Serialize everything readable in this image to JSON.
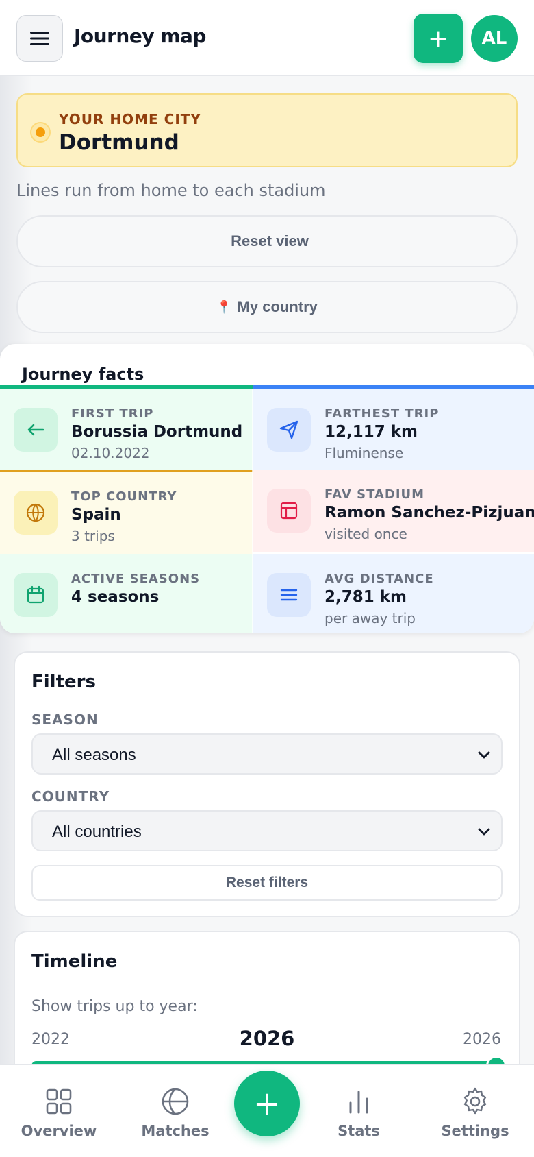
{
  "header": {
    "title": "Journey map",
    "add_label": "+",
    "avatar_initials": "AL"
  },
  "home": {
    "label": "YOUR HOME CITY",
    "city": "Dortmund"
  },
  "map_note": "Lines run from home to each stadium",
  "buttons": {
    "reset_view": "Reset view",
    "reset_view_icon": "",
    "my_country": "My country",
    "my_country_icon": "📍"
  },
  "facts": {
    "title": "Journey facts",
    "items": [
      {
        "label": "FIRST TRIP",
        "value": "Borussia Dortmund",
        "sub": "02.10.2022",
        "icon": "arrow-left-icon",
        "color": "#10b77f"
      },
      {
        "label": "FARTHEST TRIP",
        "value": "12,117 km",
        "sub": "Fluminense",
        "icon": "send-icon",
        "color": "#3b82f6"
      },
      {
        "label": "TOP COUNTRY",
        "value": "Spain",
        "sub": "3 trips",
        "icon": "globe-icon",
        "color": "#e0a020"
      },
      {
        "label": "FAV STADIUM",
        "value": "Ramon Sanchez-Pizjuan",
        "sub": "visited once",
        "icon": "stadium-icon",
        "color": "#e11d48"
      },
      {
        "label": "ACTIVE SEASONS",
        "value": "4 seasons",
        "sub": "",
        "icon": "calendar-icon",
        "color": "#10b77f"
      },
      {
        "label": "AVG DISTANCE",
        "value": "2,781 km",
        "sub": "per away trip",
        "icon": "lines-icon",
        "color": "#3b82f6"
      }
    ]
  },
  "filters": {
    "title": "Filters",
    "season_label": "SEASON",
    "season_value": "All seasons",
    "country_label": "COUNTRY",
    "country_value": "All countries",
    "reset_label": "Reset filters"
  },
  "timeline": {
    "title": "Timeline",
    "subtitle": "Show trips up to year:",
    "min_year": "2022",
    "current_year": "2026",
    "max_year": "2026",
    "progress": 1.0
  },
  "nav": {
    "overview": "Overview",
    "matches": "Matches",
    "fab_label": "+",
    "stats": "Stats",
    "settings": "Settings"
  }
}
